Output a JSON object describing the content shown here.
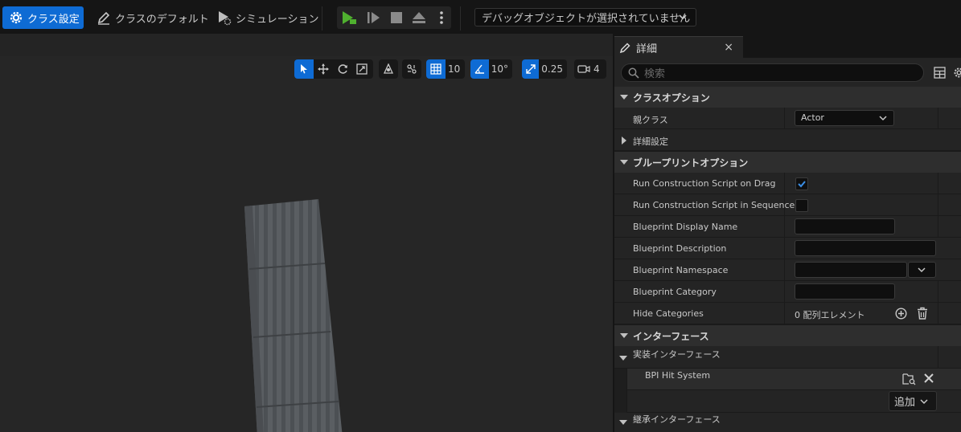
{
  "toolbar": {
    "class_settings_label": "クラス設定",
    "class_defaults_label": "クラスのデフォルト",
    "simulation_label": "シミュレーション",
    "debug_object_select": "デバッグオブジェクトが選択されていません"
  },
  "viewport_tools": {
    "grid_snap_value": "10",
    "rotation_snap_value": "10°",
    "scale_snap_value": "0.25",
    "camera_speed_value": "4"
  },
  "details": {
    "tab_title": "詳細",
    "tab_close": "×",
    "search_placeholder": "検索",
    "sections": {
      "class_options": "クラスオプション",
      "blueprint_options": "ブループリントオプション",
      "interfaces": "インターフェース"
    },
    "class_options": {
      "parent_class_label": "親クラス",
      "parent_class_value": "Actor",
      "advanced_label": "詳細設定"
    },
    "blueprint_options": {
      "run_construction_on_drag_label": "Run Construction Script on Drag",
      "run_construction_on_drag_checked": true,
      "run_construction_in_sequencer_label": "Run Construction Script in Sequencer",
      "run_construction_in_sequencer_checked": false,
      "display_name_label": "Blueprint Display Name",
      "description_label": "Blueprint Description",
      "namespace_label": "Blueprint Namespace",
      "category_label": "Blueprint Category",
      "hide_categories_label": "Hide Categories",
      "hide_categories_value": "0 配列エレメント"
    },
    "interfaces": {
      "implemented_label": "実装インターフェース",
      "implemented_items": [
        "BPI Hit System"
      ],
      "add_button_label": "追加",
      "inherited_label": "継承インターフェース"
    }
  },
  "colors": {
    "accent_blue": "#0e6bd4",
    "play_green": "#4fb02f",
    "panel_bg": "#242424",
    "viewport_bg": "#262626"
  }
}
